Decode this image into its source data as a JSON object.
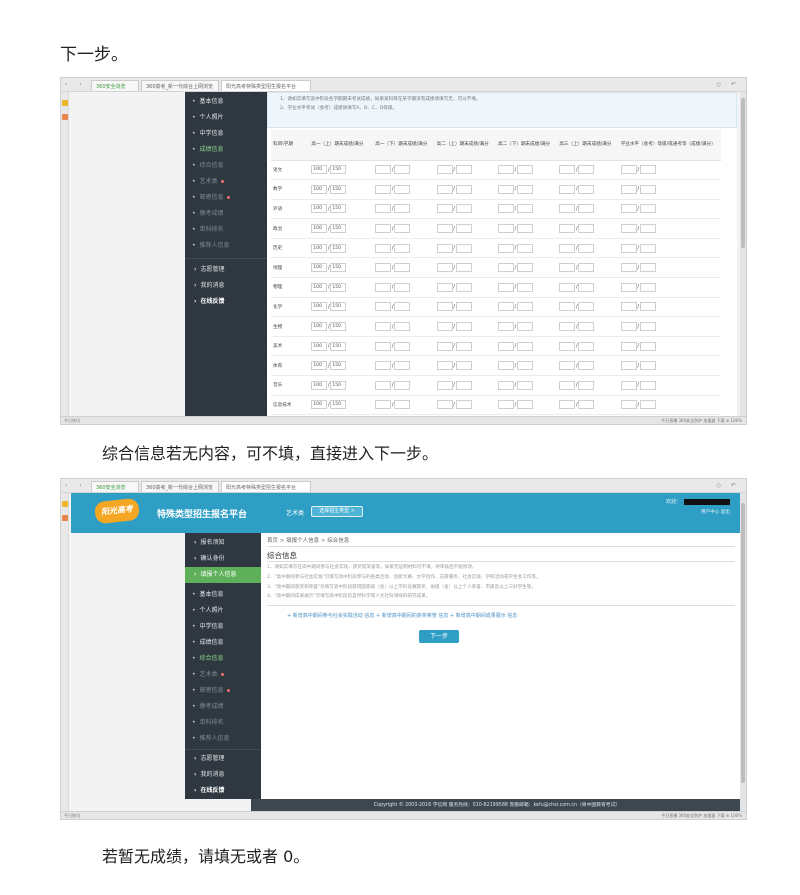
{
  "captions": {
    "c1": "下一步。",
    "c2": "综合信息若无内容，可不填，直接进入下一步。",
    "c3": "若暂无成绩，请填无或者 0。"
  },
  "browser": {
    "tab1": "360安全浏览",
    "tab2": "360高考_新一代综合上网浏览",
    "tab3": "阳光高考特殊类型招生报名平台",
    "status_left": "今日快讯",
    "status_right": "今日直播  360安全防护  加速器  下载  ⊕ 100%"
  },
  "sidebar": {
    "items": [
      {
        "label": "基本信息"
      },
      {
        "label": "个人照片"
      },
      {
        "label": "中学信息"
      },
      {
        "label": "成绩信息"
      },
      {
        "label": "综合信息"
      },
      {
        "label": "艺术类"
      },
      {
        "label": "邮寄信息"
      },
      {
        "label": "缴考成绩"
      },
      {
        "label": "单科排名"
      },
      {
        "label": "推荐人信息"
      }
    ],
    "major": [
      {
        "label": "志愿管理"
      },
      {
        "label": "我的消息"
      },
      {
        "label": "在线反馈"
      }
    ],
    "top2": [
      {
        "label": "报名须知"
      },
      {
        "label": "确认身份"
      },
      {
        "label": "填报个人信息"
      }
    ]
  },
  "shot1": {
    "notes": [
      "1、请如实填写高中阶段各学期期末考试成绩，如果某科目在某学期没有成绩请填写无，可以不填。",
      "2、学业水平考试（会考）成绩请填写A、B、C、D等级。"
    ],
    "headers": [
      "科目\\学期",
      "高一（上）期末成绩/满分",
      "高一（下）期末成绩/满分",
      "高二（上）期末成绩/满分",
      "高二（下）期末成绩/满分",
      "高三（上）期末成绩/满分",
      "学业水平（会考）等级/或通考等（成绩/满分）"
    ],
    "subjects": [
      "语文",
      "数学",
      "外语",
      "政治",
      "历史",
      "地理",
      "物理",
      "化学",
      "生物",
      "美术",
      "体育",
      "音乐",
      "信息技术",
      "文科综合",
      "理科综合"
    ],
    "sample_score": "100",
    "sample_full": "150"
  },
  "shot2": {
    "logo": "阳光高考",
    "platform_title": "特殊类型招生报名平台",
    "category": "艺术类",
    "switch_button": "选择招生类型 >",
    "welcome": "欢迎：",
    "user_links": "用户中心   退出",
    "breadcrumb": "首页 > 填报个人信息 > 综合信息",
    "section_title": "综合信息",
    "notes": [
      "1、请如实填写在高中期间参与社会实践、获奖或荣誉等，如果无证明材料可不填，待审核后不能修改。",
      "2、\"高中期间参与社会实践\"可填写高中阶段参与的各类活动、创新大赛、文学创作、志愿服务、社会实践、学校活动或学生会工作等。",
      "3、\"高中期间获奖和荣誉\"仅填写高中阶段获得国家级（含）以上学科竞赛获奖、省级（含）以上个人荣誉、市级及以上三好学生等。",
      "4、\"高中期间成果展示\"可填写高中阶段的自然科学或人文社科领域的研究成果。"
    ],
    "links": "+ 新增高中期间参与社会实践活动 信息  + 新增高中期间的获奖荣誉 信息  + 新增高中期间成果展示 信息",
    "next_button": "下一步",
    "footer": "Copyright © 2003-2016 学信网    服务热线：010-82199588    客服邮箱：kefu@chsi.com.cn（将中国教育考试）"
  }
}
